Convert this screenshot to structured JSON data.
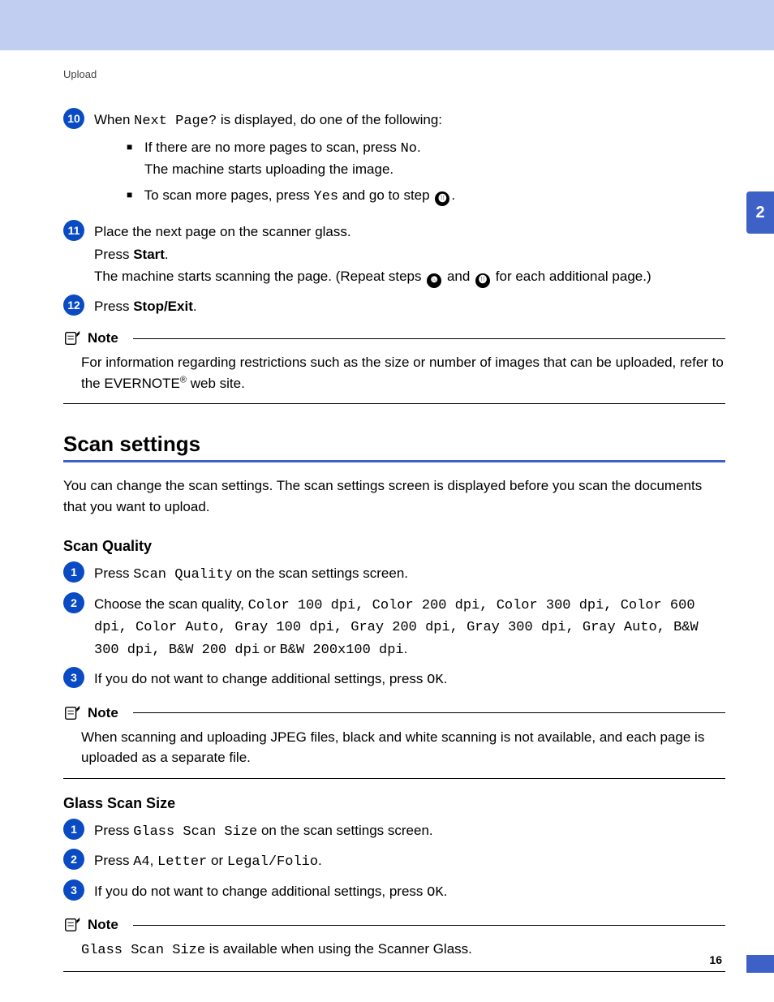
{
  "breadcrumb": "Upload",
  "chapter_tab": "2",
  "page_number": "16",
  "step10": {
    "num": "10",
    "pre": "When ",
    "mono": "Next Page?",
    "post": " is displayed, do one of the following:",
    "bul1_pre": "If there are no more pages to scan, press ",
    "bul1_mono": "No",
    "bul1_post": ".",
    "bul1_sub": "The machine starts uploading the image.",
    "bul2_pre": "To scan more pages, press ",
    "bul2_mono": "Yes",
    "bul2_post": " and go to step ",
    "bul2_ref": "⓫",
    "bul2_end": "."
  },
  "step11": {
    "num": "11",
    "l1": "Place the next page on the scanner glass.",
    "l2a": "Press ",
    "l2b": "Start",
    "l2c": ".",
    "l3a": "The machine starts scanning the page. (Repeat steps ",
    "l3ref1": "❿",
    "l3mid": " and ",
    "l3ref2": "⓫",
    "l3b": " for each additional page.)"
  },
  "step12": {
    "num": "12",
    "a": "Press ",
    "b": "Stop/Exit",
    "c": "."
  },
  "note1": {
    "title": "Note",
    "body_a": "For information regarding restrictions such as the size or number of images that can be uploaded, refer to the EVERNOTE",
    "body_b": " web site."
  },
  "section": {
    "h2": "Scan settings",
    "intro": "You can change the scan settings. The scan settings screen is displayed before you scan the documents that you want to upload."
  },
  "quality": {
    "h3": "Scan Quality",
    "s1_a": "Press ",
    "s1_mono": "Scan Quality",
    "s1_b": " on the scan settings screen.",
    "s2_a": "Choose the scan quality, ",
    "s2_list": "Color 100 dpi, Color 200 dpi, Color 300 dpi, Color 600 dpi, Color Auto, Gray 100 dpi, Gray 200 dpi, Gray 300 dpi, Gray Auto, B&W 300 dpi, B&W 200 dpi",
    "s2_or": " or ",
    "s2_last": "B&W 200x100 dpi",
    "s2_end": ".",
    "s3_a": "If you do not want to change additional settings, press ",
    "s3_mono": "OK",
    "s3_b": "."
  },
  "note2": {
    "title": "Note",
    "body": "When scanning and uploading JPEG files, black and white scanning is not available, and each page is uploaded as a separate file."
  },
  "glass": {
    "h3": "Glass Scan Size",
    "s1_a": "Press ",
    "s1_mono": "Glass Scan Size",
    "s1_b": " on the scan settings screen.",
    "s2_a": "Press ",
    "s2_m1": "A4",
    "s2_c1": ", ",
    "s2_m2": "Letter",
    "s2_or": " or ",
    "s2_m3": "Legal/Folio",
    "s2_end": ".",
    "s3_a": "If you do not want to change additional settings, press ",
    "s3_mono": "OK",
    "s3_b": "."
  },
  "note3": {
    "title": "Note",
    "body_mono": "Glass Scan Size",
    "body_rest": " is available when using the Scanner Glass."
  }
}
